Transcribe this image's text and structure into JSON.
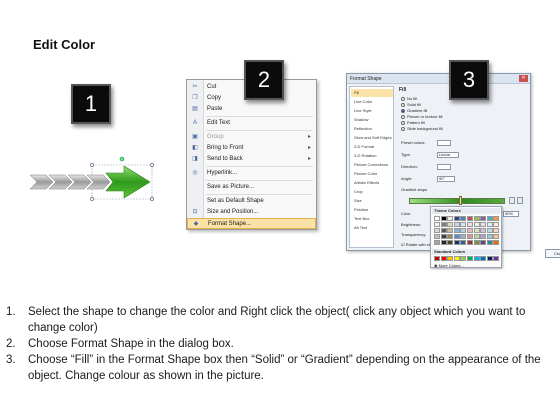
{
  "title": "Edit Color",
  "step_numbers": [
    "1",
    "2",
    "3"
  ],
  "context_menu": {
    "items": [
      {
        "label": "Cut",
        "icon": "scissors-icon",
        "disabled": false,
        "submenu": false,
        "highlight": false
      },
      {
        "label": "Copy",
        "icon": "copy-icon",
        "disabled": false,
        "submenu": false,
        "highlight": false
      },
      {
        "label": "Paste",
        "icon": "paste-icon",
        "disabled": false,
        "submenu": false,
        "highlight": false
      },
      {
        "label": "Edit Text",
        "icon": "edit-text-icon",
        "disabled": false,
        "submenu": false,
        "highlight": false
      },
      {
        "label": "Group",
        "icon": "group-icon",
        "disabled": true,
        "submenu": true,
        "highlight": false
      },
      {
        "label": "Bring to Front",
        "icon": "bring-front-icon",
        "disabled": false,
        "submenu": true,
        "highlight": false
      },
      {
        "label": "Send to Back",
        "icon": "send-back-icon",
        "disabled": false,
        "submenu": true,
        "highlight": false
      },
      {
        "label": "Hyperlink...",
        "icon": "hyperlink-icon",
        "disabled": false,
        "submenu": false,
        "highlight": false
      },
      {
        "label": "Save as Picture...",
        "icon": "",
        "disabled": false,
        "submenu": false,
        "highlight": false
      },
      {
        "label": "Set as Default Shape",
        "icon": "",
        "disabled": false,
        "submenu": false,
        "highlight": false
      },
      {
        "label": "Size and Position...",
        "icon": "size-position-icon",
        "disabled": false,
        "submenu": false,
        "highlight": false
      },
      {
        "label": "Format Shape...",
        "icon": "format-shape-icon",
        "disabled": false,
        "submenu": false,
        "highlight": true
      }
    ]
  },
  "format_dialog": {
    "title": "Format Shape",
    "sidebar": [
      "Fill",
      "Line Color",
      "Line Style",
      "Shadow",
      "Reflection",
      "Glow and Soft Edges",
      "3-D Format",
      "3-D Rotation",
      "Picture Corrections",
      "Picture Color",
      "Artistic Effects",
      "Crop",
      "Size",
      "Position",
      "Text Box",
      "Alt Text"
    ],
    "pane_title": "Fill",
    "radios": [
      "No fill",
      "Solid fill",
      "Gradient fill",
      "Picture or texture fill",
      "Pattern fill",
      "Slide background fill"
    ],
    "selected_radio": "Gradient fill",
    "fields": {
      "preset_label": "Preset colors:",
      "type_label": "Type:",
      "type_value": "Linear",
      "direction_label": "Direction:",
      "angle_label": "Angle:",
      "angle_value": "90°",
      "stops_label": "Gradient stops",
      "color_label": "Color",
      "position_label": "Position:",
      "position_value": "50%",
      "brightness_label": "Brightness:",
      "transparency_label": "Transparency:",
      "rotate_label": "Rotate with shape"
    },
    "close_label": "Close",
    "palette": {
      "theme_title": "Theme Colors",
      "standard_title": "Standard Colors",
      "more_label": "More Colors...",
      "theme_colors": [
        [
          "#ffffff",
          "#000000",
          "#eeece1",
          "#1f497d",
          "#4f81bd",
          "#c0504d",
          "#9bbb59",
          "#8064a2",
          "#4bacc6",
          "#f79646"
        ],
        [
          "#f2f2f2",
          "#7f7f7f",
          "#ddd9c3",
          "#c6d9f0",
          "#dbe5f1",
          "#f2dcdb",
          "#ebf1dd",
          "#e5e0ec",
          "#dbeef3",
          "#fdeada"
        ],
        [
          "#d8d8d8",
          "#595959",
          "#c4bd97",
          "#8db3e2",
          "#b8cce4",
          "#e5b9b7",
          "#d7e3bc",
          "#ccc1d9",
          "#b7dde8",
          "#fbd5b5"
        ],
        [
          "#bfbfbf",
          "#3f3f3f",
          "#938953",
          "#548dd4",
          "#95b3d7",
          "#d99694",
          "#c3d69b",
          "#b2a2c7",
          "#92cddc",
          "#fac08f"
        ],
        [
          "#a5a5a5",
          "#262626",
          "#494429",
          "#17365d",
          "#366092",
          "#953734",
          "#76923c",
          "#5f497a",
          "#31859b",
          "#e36c09"
        ]
      ],
      "standard_colors": [
        "#c00000",
        "#ff0000",
        "#ffc000",
        "#ffff00",
        "#92d050",
        "#00b050",
        "#00b0f0",
        "#0070c0",
        "#002060",
        "#7030a0"
      ]
    }
  },
  "instructions": [
    {
      "num": "1.",
      "text": "Select the shape to change the color and Right click the object( click any object which you want to change color)"
    },
    {
      "num": "2.",
      "text": "Choose Format Shape in the dialog box."
    },
    {
      "num": "3.",
      "text": "Choose “Fill” in the Format Shape box then “Solid” or “Gradient” depending on the appearance of the object. Change colour as shown in the picture."
    }
  ]
}
